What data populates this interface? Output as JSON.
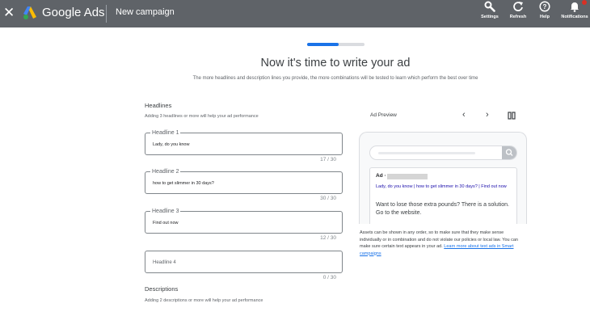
{
  "header": {
    "app_name": "Google Ads",
    "page_title": "New campaign",
    "tools": [
      {
        "label": "Settings",
        "icon": "wrench-icon"
      },
      {
        "label": "Refresh",
        "icon": "refresh-icon"
      },
      {
        "label": "Help",
        "icon": "help-icon"
      },
      {
        "label": "Notifications",
        "icon": "bell-icon"
      }
    ]
  },
  "progress": {
    "fraction": 0.55
  },
  "main": {
    "title": "Now it's time to write your ad",
    "subtitle": "The more headlines and description lines you provide, the more combinations will be tested to learn which perform the best over time"
  },
  "headlines": {
    "title": "Headlines",
    "hint": "Adding 3 headlines or more will help your ad performance",
    "fields": [
      {
        "label": "Headline 1",
        "value": "Lady, do you know",
        "counter": "17 / 30"
      },
      {
        "label": "Headline 2",
        "value": "how to get slimmer in 30 days?",
        "counter": "30 / 30"
      },
      {
        "label": "Headline 3",
        "value": "Find out now",
        "counter": "12 / 30"
      },
      {
        "placeholder": "Headline 4",
        "counter": "0 / 30"
      }
    ]
  },
  "descriptions": {
    "title": "Descriptions",
    "hint": "Adding 2 descriptions or more will help your ad performance"
  },
  "preview": {
    "label": "Ad Preview",
    "ad_tag": "Ad ·",
    "headline": "Lady, do you know | how to get slimmer in 30 days? | Find out now",
    "description": "Want to lose those extra pounds? There is a solution. Go to the website.",
    "disclaimer": "Assets can be shown in any order, so to make sure that they make sense individually or in combination and do not violate our policies or local law. You can make sure certain text appears in your ad.",
    "link": "Learn more about text ads in Smart campaigns"
  },
  "colors": {
    "topbar": "#5f6368",
    "accent": "#1a73e8",
    "badge": "#d93025"
  }
}
